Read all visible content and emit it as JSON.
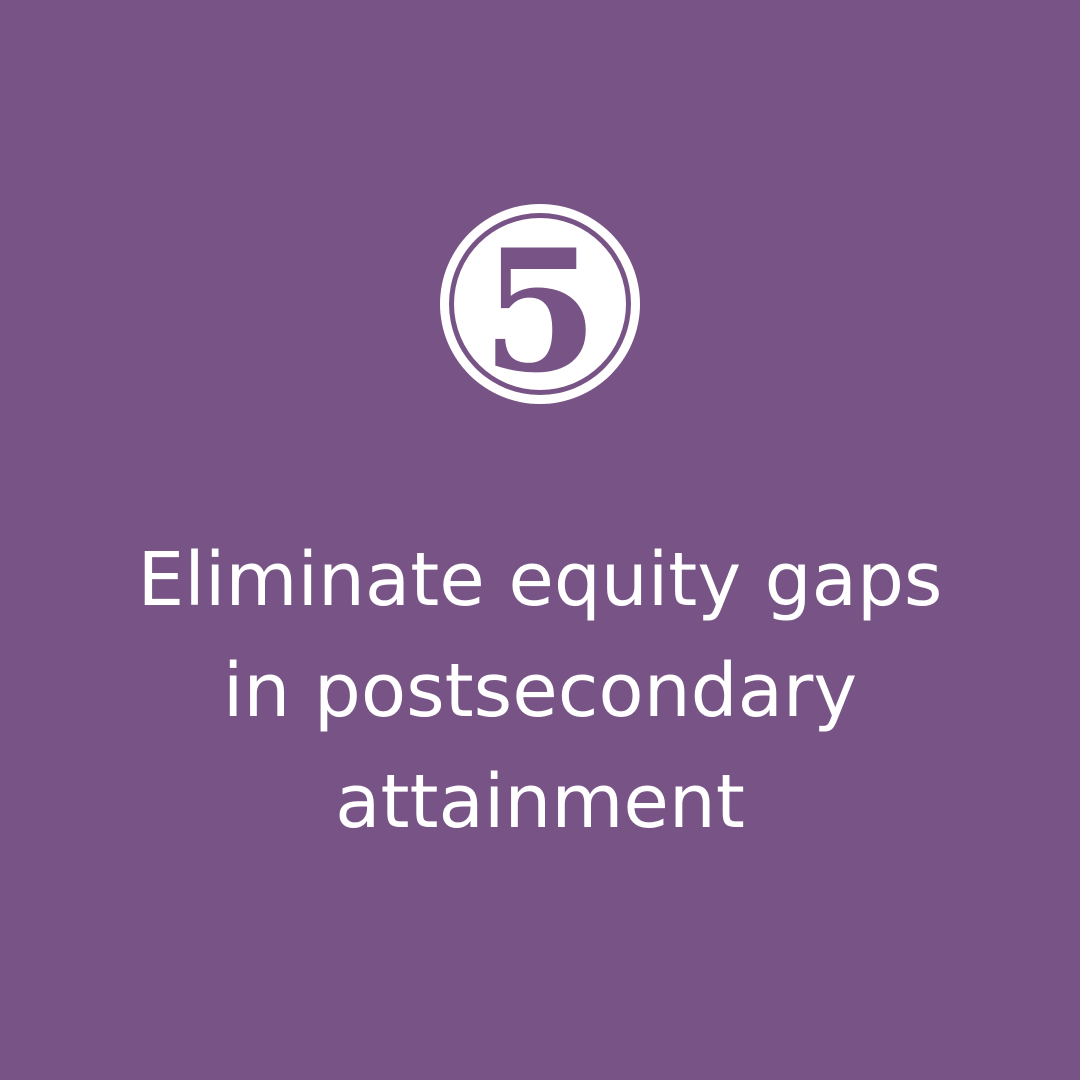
{
  "colors": {
    "background": "#785486",
    "foreground": "#ffffff"
  },
  "badge": {
    "number": "5"
  },
  "headline": {
    "lines": [
      "Eliminate equity gaps",
      "in postsecondary",
      "attainment"
    ]
  }
}
